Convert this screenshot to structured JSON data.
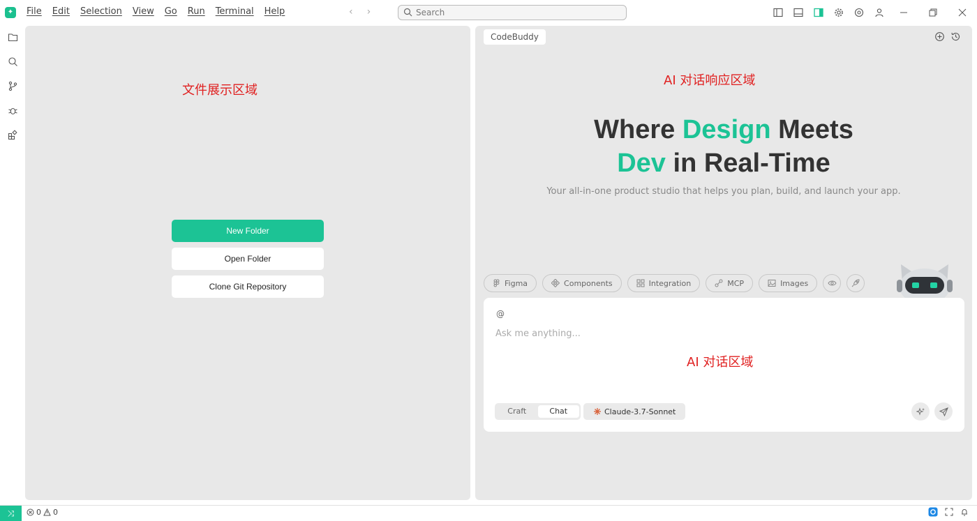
{
  "menu": [
    "File",
    "Edit",
    "Selection",
    "View",
    "Go",
    "Run",
    "Terminal",
    "Help"
  ],
  "search": {
    "placeholder": "Search"
  },
  "left": {
    "note": "文件展示区域",
    "buttons": {
      "new_folder": "New Folder",
      "open_folder": "Open Folder",
      "clone_repo": "Clone Git Repository"
    }
  },
  "right": {
    "tab": "CodeBuddy",
    "note_top": "AI 对话响应区域",
    "headline": {
      "w1": "Where ",
      "w2": "Design",
      "w3": " Meets",
      "w4": "Dev",
      "w5": " in Real-Time"
    },
    "subtitle": "Your all-in-one product studio that helps you plan, build, and launch your app.",
    "chips": [
      "Figma",
      "Components",
      "Integration",
      "MCP",
      "Images"
    ],
    "chat": {
      "at": "@",
      "placeholder": "Ask me anything...",
      "note": "AI 对话区域",
      "modes": [
        "Craft",
        "Chat"
      ],
      "active_mode": "Chat",
      "model": "Claude-3.7-Sonnet"
    }
  },
  "status": {
    "errors": "0",
    "warnings": "0"
  },
  "colors": {
    "accent": "#1cc395",
    "note": "#e02020"
  }
}
